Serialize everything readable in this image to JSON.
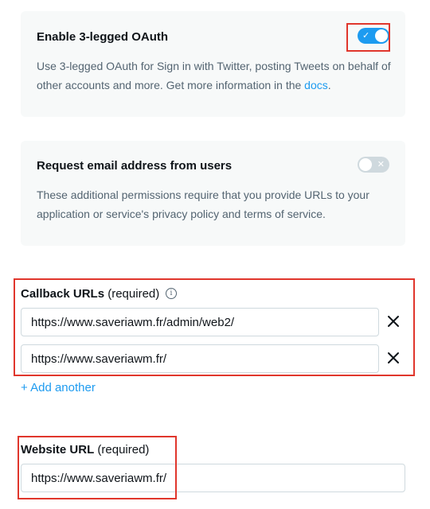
{
  "oauth_card": {
    "title": "Enable 3-legged OAuth",
    "description_text": "Use 3-legged OAuth for Sign in with Twitter, posting Tweets on behalf of other accounts and more. Get more information in the ",
    "docs_link": "docs",
    "description_end": ".",
    "toggle_state": "on",
    "toggle_glyph": "✓"
  },
  "email_card": {
    "title": "Request email address from users",
    "description": "These additional permissions require that you provide URLs to your application or service's privacy policy and terms of service.",
    "toggle_state": "off",
    "toggle_glyph": "✕"
  },
  "callback": {
    "label": "Callback URLs",
    "required": "(required)",
    "info_icon": "info-icon",
    "urls": [
      "https://www.saveriawm.fr/admin/web2/",
      "https://www.saveriawm.fr/"
    ],
    "remove_glyph": "✕",
    "add_another": "+ Add another"
  },
  "website": {
    "label": "Website URL",
    "required": "(required)",
    "value": "https://www.saveriawm.fr/"
  },
  "colors": {
    "accent": "#1d9bf0",
    "highlight": "#e0362c",
    "card_bg": "#f7f9f9"
  }
}
